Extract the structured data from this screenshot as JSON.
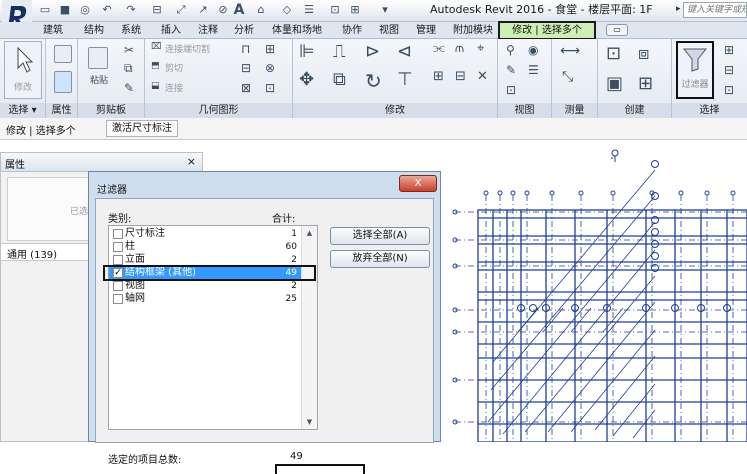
{
  "titlebar": {
    "title": "Autodesk Revit 2016 -   食堂 - 楼层平面: 1F",
    "search_placeholder": "键入关键字或短语"
  },
  "tabs": [
    "建筑",
    "结构",
    "系统",
    "插入",
    "注释",
    "分析",
    "体量和场地",
    "协作",
    "视图",
    "管理",
    "附加模块"
  ],
  "active_tab": "修改 | 选择多个",
  "ribbon": {
    "panels": [
      "选择 ▾",
      "属性",
      "剪贴板",
      "几何图形",
      "修改",
      "视图",
      "测量",
      "创建",
      "选择"
    ],
    "modify_button": "修改",
    "paste_button": "粘贴",
    "cut_join": "连接端切割",
    "cut": "剪切",
    "join": "连接",
    "filter_button": "过滤器"
  },
  "options_bar": {
    "mode": "修改 | 选择多个",
    "activate_dimensions": "激活尺寸标注"
  },
  "properties_panel": {
    "title": "属性",
    "close": "×",
    "type_label": "已选择",
    "row_label": "通用 (139)"
  },
  "filter_dialog": {
    "title": "过滤器",
    "close": "X",
    "category_header": "类别:",
    "count_header": "合计:",
    "categories": [
      {
        "name": "尺寸标注",
        "count": "1",
        "checked": false
      },
      {
        "name": "柱",
        "count": "60",
        "checked": false
      },
      {
        "name": "立面",
        "count": "2",
        "checked": false
      },
      {
        "name": "结构框架 (其他)",
        "count": "49",
        "checked": true
      },
      {
        "name": "视图",
        "count": "2",
        "checked": false
      },
      {
        "name": "轴网",
        "count": "25",
        "checked": false
      }
    ],
    "select_all": "选择全部(A)",
    "clear_all": "放弃全部(N)",
    "total_label": "选定的项目总数:",
    "total_value": "49"
  },
  "colors": {
    "active_tab": "#cdeeb4",
    "selected_row": "#3399ff",
    "plan_lines": "#1f3f99"
  }
}
